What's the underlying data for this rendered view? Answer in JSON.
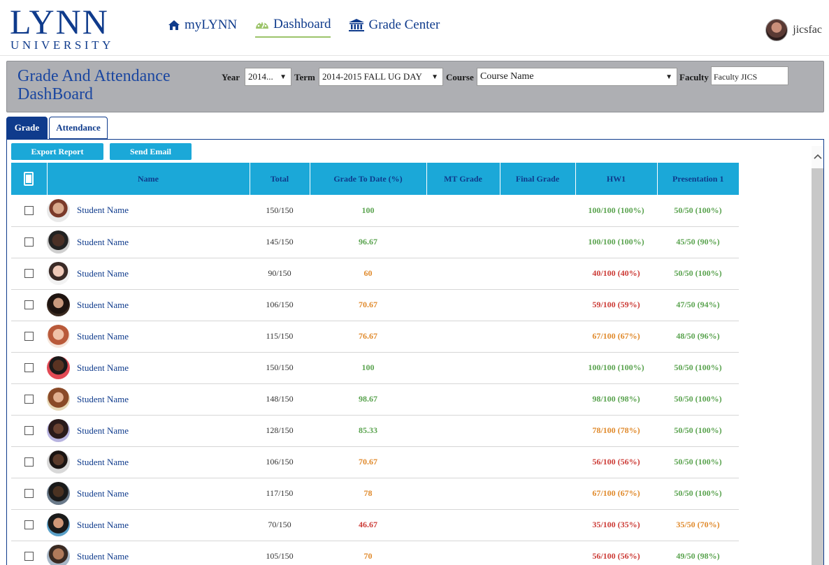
{
  "brand": {
    "name": "LYNN",
    "sub": "UNIVERSITY",
    "color": "#0f3b8c"
  },
  "nav": [
    {
      "label": "myLYNN",
      "icon": "home-icon"
    },
    {
      "label": "Dashboard",
      "icon": "dashboard-gauge-icon",
      "active": true
    },
    {
      "label": "Grade Center",
      "icon": "institution-icon"
    }
  ],
  "user": {
    "name": "jicsfac"
  },
  "panel": {
    "title_line1": "Grade And Attendance",
    "title_line2": "DashBoard",
    "year_label": "Year",
    "year_value": "2014...",
    "term_label": "Term",
    "term_value": "2014-2015 FALL UG DAY",
    "course_label": "Course",
    "course_value": "Course Name",
    "faculty_label": "Faculty",
    "faculty_value": "Faculty JICS"
  },
  "tabs": {
    "grade": "Grade",
    "attendance": "Attendance"
  },
  "actions": {
    "export": "Export Report",
    "email": "Send Email"
  },
  "columns": [
    "Name",
    "Total",
    "Grade To Date (%)",
    "MT Grade",
    "Final Grade",
    "HW1",
    "Presentation 1"
  ],
  "rows": [
    {
      "name": "Student Name",
      "total": "150/150",
      "grade": "100",
      "grade_status": "green",
      "mt": "",
      "final": "",
      "hw1": "100/100 (100%)",
      "hw1_status": "green",
      "pres1": "50/50 (100%)",
      "pres1_status": "green"
    },
    {
      "name": "Student Name",
      "total": "145/150",
      "grade": "96.67",
      "grade_status": "green",
      "mt": "",
      "final": "",
      "hw1": "100/100 (100%)",
      "hw1_status": "green",
      "pres1": "45/50 (90%)",
      "pres1_status": "green"
    },
    {
      "name": "Student Name",
      "total": "90/150",
      "grade": "60",
      "grade_status": "orange",
      "mt": "",
      "final": "",
      "hw1": "40/100 (40%)",
      "hw1_status": "red",
      "pres1": "50/50 (100%)",
      "pres1_status": "green"
    },
    {
      "name": "Student Name",
      "total": "106/150",
      "grade": "70.67",
      "grade_status": "orange",
      "mt": "",
      "final": "",
      "hw1": "59/100 (59%)",
      "hw1_status": "red",
      "pres1": "47/50 (94%)",
      "pres1_status": "green"
    },
    {
      "name": "Student Name",
      "total": "115/150",
      "grade": "76.67",
      "grade_status": "orange",
      "mt": "",
      "final": "",
      "hw1": "67/100 (67%)",
      "hw1_status": "orange",
      "pres1": "48/50 (96%)",
      "pres1_status": "green"
    },
    {
      "name": "Student Name",
      "total": "150/150",
      "grade": "100",
      "grade_status": "green",
      "mt": "",
      "final": "",
      "hw1": "100/100 (100%)",
      "hw1_status": "green",
      "pres1": "50/50 (100%)",
      "pres1_status": "green"
    },
    {
      "name": "Student Name",
      "total": "148/150",
      "grade": "98.67",
      "grade_status": "green",
      "mt": "",
      "final": "",
      "hw1": "98/100 (98%)",
      "hw1_status": "green",
      "pres1": "50/50 (100%)",
      "pres1_status": "green"
    },
    {
      "name": "Student Name",
      "total": "128/150",
      "grade": "85.33",
      "grade_status": "green",
      "mt": "",
      "final": "",
      "hw1": "78/100 (78%)",
      "hw1_status": "orange",
      "pres1": "50/50 (100%)",
      "pres1_status": "green"
    },
    {
      "name": "Student Name",
      "total": "106/150",
      "grade": "70.67",
      "grade_status": "orange",
      "mt": "",
      "final": "",
      "hw1": "56/100 (56%)",
      "hw1_status": "red",
      "pres1": "50/50 (100%)",
      "pres1_status": "green"
    },
    {
      "name": "Student Name",
      "total": "117/150",
      "grade": "78",
      "grade_status": "orange",
      "mt": "",
      "final": "",
      "hw1": "67/100 (67%)",
      "hw1_status": "orange",
      "pres1": "50/50 (100%)",
      "pres1_status": "green"
    },
    {
      "name": "Student Name",
      "total": "70/150",
      "grade": "46.67",
      "grade_status": "red",
      "mt": "",
      "final": "",
      "hw1": "35/100 (35%)",
      "hw1_status": "red",
      "pres1": "35/50 (70%)",
      "pres1_status": "orange"
    },
    {
      "name": "Student Name",
      "total": "105/150",
      "grade": "70",
      "grade_status": "orange",
      "mt": "",
      "final": "",
      "hw1": "56/100 (56%)",
      "hw1_status": "red",
      "pres1": "49/50 (98%)",
      "pres1_status": "green"
    }
  ],
  "colors": {
    "header_bg": "#1ba8d8",
    "green": "#5aa34f",
    "orange": "#e08a2c",
    "red": "#cc3b36"
  }
}
